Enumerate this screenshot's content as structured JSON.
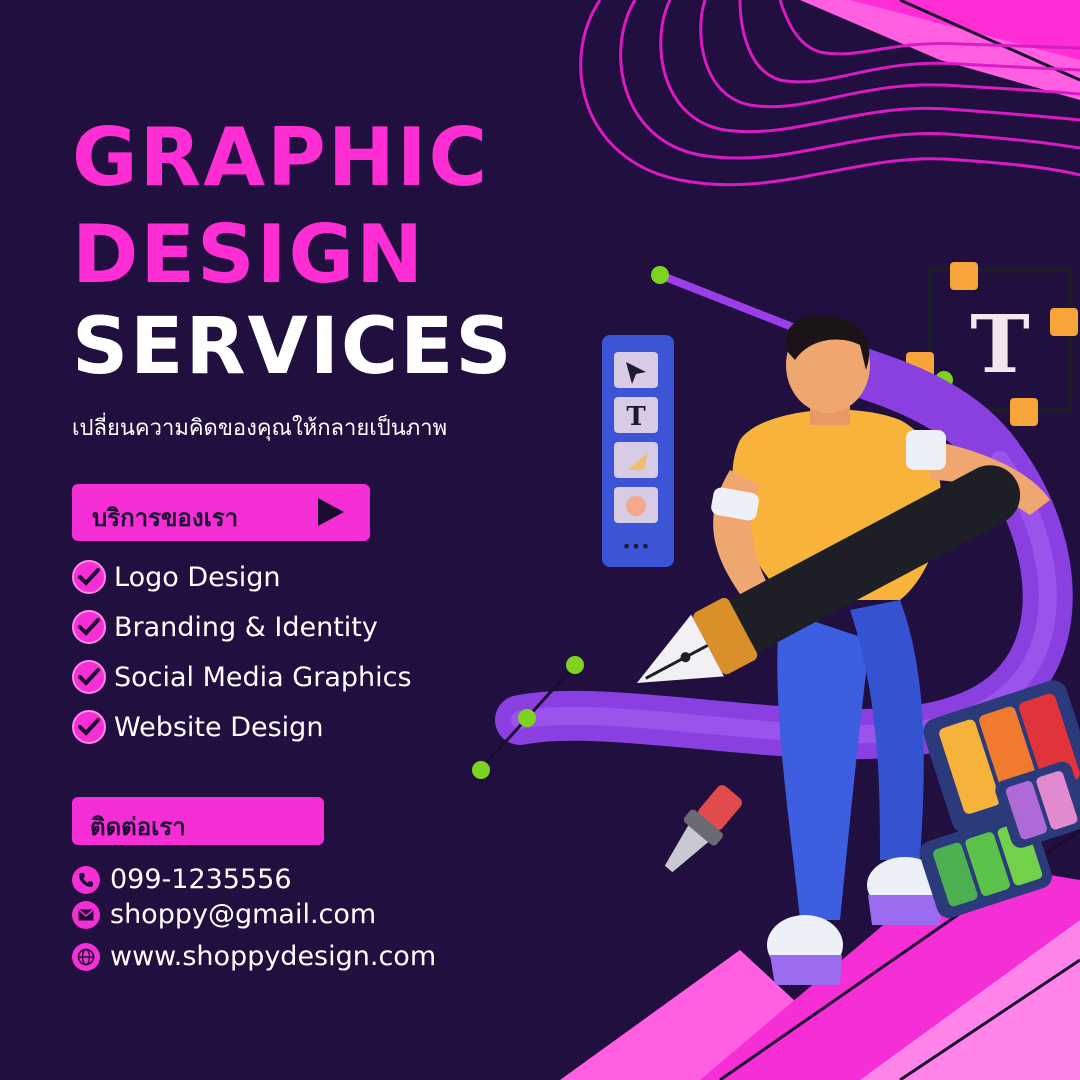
{
  "headline": {
    "line1": "GRAPHIC",
    "line2": "DESIGN",
    "line3": "SERVICES"
  },
  "subtitle": "เปลี่ยนความคิดของคุณให้กลายเป็นภาพ",
  "services": {
    "heading": "บริการของเรา",
    "items": [
      {
        "label": "Logo Design"
      },
      {
        "label": "Branding & Identity"
      },
      {
        "label": "Social Media Graphics"
      },
      {
        "label": "Website Design"
      }
    ]
  },
  "contact": {
    "heading": "ติดต่อเรา",
    "phone": "099-1235556",
    "email": "shoppy@gmail.com",
    "website": "www.shoppydesign.com"
  },
  "illustration": {
    "toolbar_letter": "T",
    "textbox_letter": "T",
    "toolbar_more": "•••"
  },
  "colors": {
    "background": "#200f3f",
    "accent": "#f52ed6",
    "headline_pink": "#ff2ed4",
    "text": "#ffffff"
  }
}
